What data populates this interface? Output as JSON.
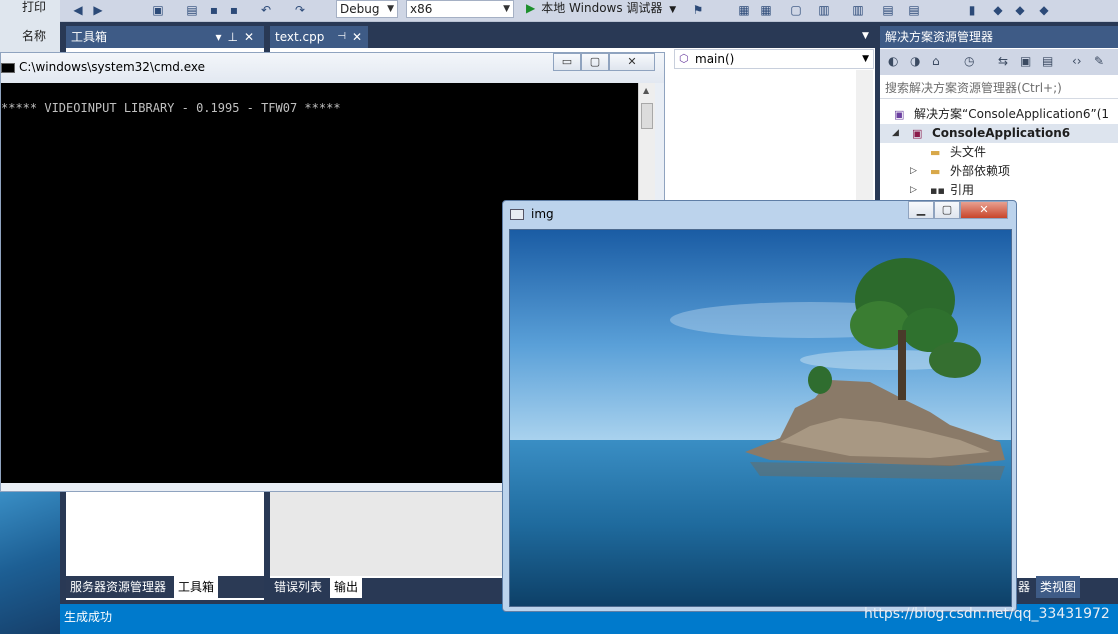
{
  "desktop": {
    "print_label": "打印",
    "name_label": "名称"
  },
  "toolbar": {
    "config": "Debug",
    "platform": "x86",
    "run_label": "本地 Windows 调试器"
  },
  "toolbox": {
    "title": "工具箱",
    "tabs": [
      "服务器资源管理器",
      "工具箱"
    ]
  },
  "editor": {
    "tab": "text.cpp",
    "member": "main()"
  },
  "output": {
    "tabs": [
      "错误列表",
      "输出"
    ]
  },
  "solution": {
    "title": "解决方案资源管理器",
    "search_placeholder": "搜索解决方案资源管理器(Ctrl+;)",
    "items": [
      {
        "label": "解决方案“ConsoleApplication6”(1"
      },
      {
        "label": "ConsoleApplication6"
      },
      {
        "label": "头文件"
      },
      {
        "label": "外部依赖项"
      },
      {
        "label": "引用"
      }
    ],
    "bottom_tabs": [
      "器",
      "类视图"
    ]
  },
  "status": {
    "text": "生成成功"
  },
  "cmd": {
    "title": "C:\\windows\\system32\\cmd.exe",
    "output": "***** VIDEOINPUT LIBRARY - 0.1995 - TFW07 *****"
  },
  "img_window": {
    "title": "img"
  },
  "watermark": "https://blog.csdn.net/qq_33431972",
  "colors": {
    "titlebar": "#3e5b86",
    "statusbar": "#007acc",
    "frame": "#293955"
  }
}
